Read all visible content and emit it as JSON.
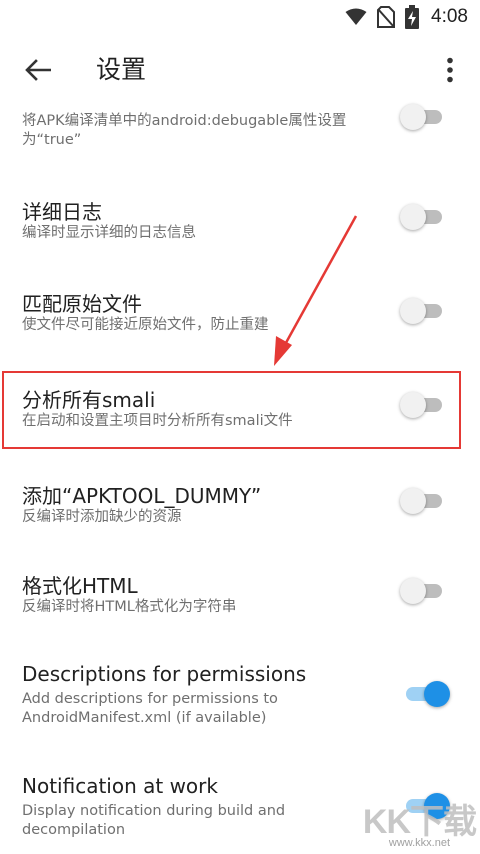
{
  "status_bar": {
    "time": "4:08",
    "icons": [
      "wifi-icon",
      "no-sim-icon",
      "battery-charging-icon"
    ]
  },
  "app_bar": {
    "title": "设置",
    "back_icon": "arrow-left-icon",
    "overflow_icon": "more-vert-icon"
  },
  "settings": [
    {
      "title": "",
      "subtitle": "将APK编译清单中的android:debugable属性设置为“true”",
      "enabled": false
    },
    {
      "title": "详细日志",
      "subtitle": "编译时显示详细的日志信息",
      "enabled": false
    },
    {
      "title": "匹配原始文件",
      "subtitle": "使文件尽可能接近原始文件，防止重建",
      "enabled": false
    },
    {
      "title": "分析所有smali",
      "subtitle": "在启动和设置主项目时分析所有smali文件",
      "enabled": false
    },
    {
      "title": "添加“APKTOOL_DUMMY”",
      "subtitle": "反编译时添加缺少的资源",
      "enabled": false
    },
    {
      "title": "格式化HTML",
      "subtitle": "反编译时将HTML格式化为字符串",
      "enabled": false
    },
    {
      "title": "Descriptions for permissions",
      "subtitle": "Add descriptions for permissions to AndroidManifest.xml (if available)",
      "enabled": true
    },
    {
      "title": "Notification at work",
      "subtitle": "Display notification during build and decompilation",
      "enabled": true
    }
  ],
  "annotation": {
    "color": "#e53935"
  },
  "watermark": {
    "logo": "KK下载",
    "url": "www.kkx.net"
  },
  "colors": {
    "accent": "#1e90e6",
    "accent_track": "#9fd1f4",
    "off_track": "#bdbdbd"
  }
}
